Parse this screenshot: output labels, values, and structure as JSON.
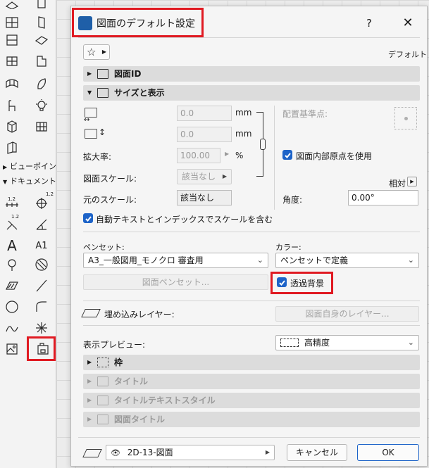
{
  "toolbox": {
    "section_viewpoints": "ビューポイント",
    "section_document": "ドキュメント",
    "tool_text_label": "A",
    "tool_label_text": "A1",
    "dim_label_1": "1.2",
    "dim_label_2": "1.2",
    "dim_label_3": "1.2"
  },
  "dialog": {
    "title": "図面のデフォルト設定",
    "help": "?",
    "close": "✕",
    "favorites_icon": "☆",
    "default_label": "デフォルト",
    "panels": {
      "drawing_id": "図面ID",
      "size_display": "サイズと表示",
      "frame": "枠",
      "title": "タイトル",
      "title_text_style": "タイトルテキストスタイル",
      "drawing_title": "図面タイトル"
    },
    "size": {
      "width_value": "0.0",
      "width_unit": "mm",
      "height_value": "0.0",
      "height_unit": "mm",
      "scale_label": "拡大率:",
      "scale_value": "100.00",
      "scale_unit": "%",
      "drawing_scale_label": "図面スケール:",
      "drawing_scale_value": "該当なし",
      "original_scale_label": "元のスケール:",
      "original_scale_value": "該当なし",
      "anchor_label": "配置基準点:",
      "use_origin_label": "図面内部原点を使用",
      "relative_label": "相対",
      "angle_label": "角度:",
      "angle_value": "0.00°",
      "auto_text_label": "自動テキストとインデックスでスケールを含む"
    },
    "pen": {
      "penset_label": "ペンセット:",
      "penset_value": "A3_一般図用_モノクロ 審査用",
      "color_label": "カラー:",
      "color_value": "ペンセットで定義",
      "drawing_penset_button": "図面ペンセット...",
      "transparent_bg_label": "透過背景"
    },
    "layer": {
      "embed_layer_label": "埋め込みレイヤー:",
      "own_layer_button": "図面自身のレイヤー..."
    },
    "preview": {
      "label": "表示プレビュー:",
      "value": "高精度"
    },
    "footer": {
      "layer_value": "2D-13-図面",
      "cancel": "キャンセル",
      "ok": "OK"
    }
  },
  "colors": {
    "accent": "#1d63c8",
    "highlight_box": "#e01a22"
  }
}
